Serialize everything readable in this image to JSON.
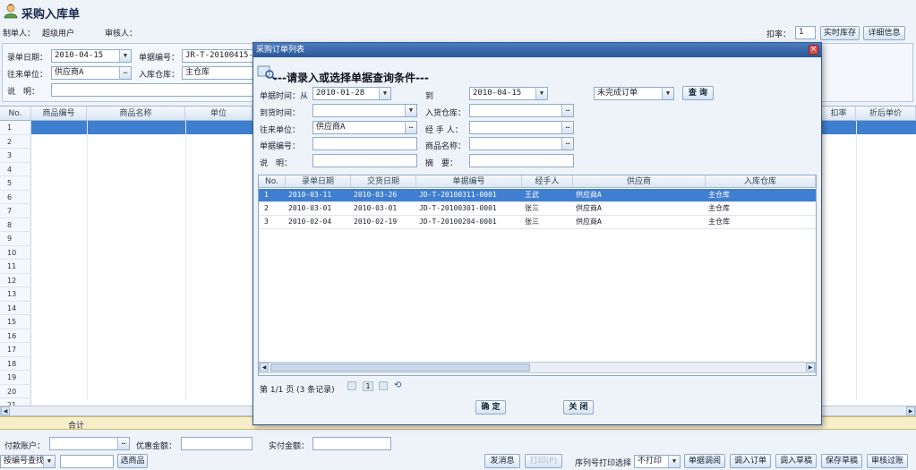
{
  "header": {
    "icon": "user-icon",
    "title": "采购入库单"
  },
  "toolbar": {
    "creator_label": "制单人：",
    "creator_value": "超级用户",
    "reviewer_label": "审核人：",
    "discount_label": "扣率：",
    "discount_value": "1",
    "stock_btn": "实时库存",
    "detail_btn": "详细信息"
  },
  "form": {
    "date_label": "录单日期：",
    "date_value": "2010-04-15",
    "docno_label": "单据编号：",
    "docno_value": "JR-T-20100415-0001",
    "partner_label": "往来单位：",
    "partner_value": "供应商A",
    "warehouse_label": "入库仓库：",
    "warehouse_value": "主仓库",
    "note_label": "说　明："
  },
  "main_grid": {
    "columns": [
      "No.",
      "商品编号",
      "商品名称",
      "单位",
      "扣率",
      "折后单价"
    ],
    "rows": [
      "1",
      "2",
      "3",
      "4",
      "5",
      "6",
      "7",
      "8",
      "9",
      "10",
      "11",
      "12",
      "13",
      "14",
      "15",
      "16",
      "17",
      "18",
      "19",
      "20",
      "21"
    ],
    "total_label": "合计"
  },
  "bottom": {
    "pay_account_label": "付款账户：",
    "discount_amount_label": "优惠金额：",
    "paid_label": "实付金额：",
    "find_by_label": "按编号查找",
    "select_goods_btn": "选商品",
    "buttons": {
      "send_msg": "发消息",
      "print": "打印(P)",
      "serial_print_label": "序列号打印选择",
      "no_print": "不打印",
      "adjust": "单据调阅",
      "import_order": "调入订单",
      "import_draft": "调入草稿",
      "save_draft": "保存草稿",
      "approve": "审核过账"
    }
  },
  "dialog": {
    "title": "采购订单列表",
    "heading": "---请录入或选择单据查询条件---",
    "from_label": "单据时间：从",
    "from_value": "2010-01-28",
    "to_label": "到",
    "to_value": "2010-04-15",
    "status_value": "未完成订单",
    "query_btn": "查 询",
    "arrival_label": "到货时间：",
    "inwh_label": "入货仓库：",
    "partner_label": "往来单位：",
    "partner_value": "供应商A",
    "handler_label": "经 手 人：",
    "docno_label": "单据编号：",
    "goods_label": "商品名称：",
    "note_label": "说　明：",
    "summary_label": "摘　要：",
    "columns": [
      "No.",
      "录单日期",
      "交货日期",
      "单据编号",
      "经手人",
      "供应商",
      "入库仓库"
    ],
    "rows": [
      {
        "no": "1",
        "date": "2010-03-11",
        "delivery": "2010-03-26",
        "docno": "JD-T-20100311-0001",
        "handler": "王武",
        "supplier": "供应商A",
        "warehouse": "主仓库"
      },
      {
        "no": "2",
        "date": "2010-03-01",
        "delivery": "2010-03-01",
        "docno": "JD-T-20100301-0001",
        "handler": "张三",
        "supplier": "供应商A",
        "warehouse": "主仓库"
      },
      {
        "no": "3",
        "date": "2010-02-04",
        "delivery": "2010-02-19",
        "docno": "JD-T-20100204-0001",
        "handler": "张三",
        "supplier": "供应商A",
        "warehouse": "主仓库"
      }
    ],
    "pager_text": "第 1/1 页 (3 条记录)",
    "page_number": "1",
    "ok_btn": "确 定",
    "close_btn": "关 闭"
  }
}
